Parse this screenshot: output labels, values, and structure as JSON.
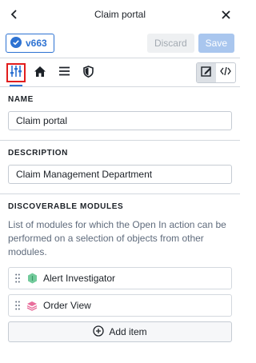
{
  "header": {
    "title": "Claim portal",
    "back_icon": "chevron-left-icon",
    "close_icon": "close-icon"
  },
  "toolbar": {
    "version_label": "v663",
    "discard_label": "Discard",
    "save_label": "Save"
  },
  "tabs": [
    {
      "icon": "sliders-icon",
      "active": true
    },
    {
      "icon": "home-icon",
      "active": false
    },
    {
      "icon": "menu-icon",
      "active": false
    },
    {
      "icon": "shield-icon",
      "active": false
    }
  ],
  "view_toggle": [
    {
      "icon": "edit-form-icon",
      "active": true
    },
    {
      "icon": "code-icon",
      "active": false
    }
  ],
  "name_section": {
    "label": "NAME",
    "value": "Claim portal"
  },
  "description_section": {
    "label": "DESCRIPTION",
    "value": "Claim Management Department"
  },
  "modules_section": {
    "label": "DISCOVERABLE MODULES",
    "description": "List of modules for which the Open In action can be performed on a selection of objects from other modules.",
    "items": [
      {
        "label": "Alert Investigator",
        "icon": "green-badge-icon",
        "color": "#72ca9b"
      },
      {
        "label": "Order View",
        "icon": "pink-layers-icon",
        "color": "#e86d9b"
      }
    ],
    "add_label": "Add item"
  },
  "colors": {
    "accent": "#2d72d2",
    "highlight": "#e21d1d"
  }
}
